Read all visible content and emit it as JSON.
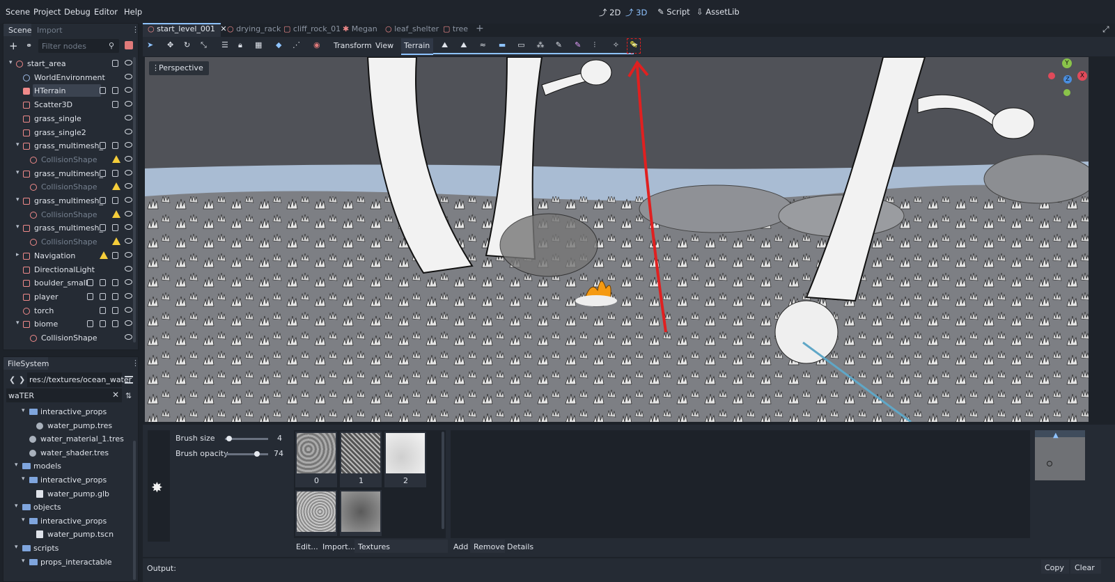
{
  "menubar": {
    "items": [
      "Scene",
      "Project",
      "Debug",
      "Editor",
      "Help"
    ],
    "modes": [
      {
        "label": "2D",
        "icon": "2d-icon",
        "active": false
      },
      {
        "label": "3D",
        "icon": "3d-icon",
        "active": true
      },
      {
        "label": "Script",
        "icon": "script-icon",
        "active": false
      },
      {
        "label": "AssetLib",
        "icon": "assetlib-icon",
        "active": false
      }
    ]
  },
  "scene_dock": {
    "tabs": [
      "Scene",
      "Import"
    ],
    "filter_placeholder": "Filter nodes",
    "nodes": [
      {
        "label": "start_area",
        "depth": 0,
        "dim": false
      },
      {
        "label": "WorldEnvironment",
        "depth": 1,
        "dim": false
      },
      {
        "label": "HTerrain",
        "depth": 1,
        "dim": false
      },
      {
        "label": "Scatter3D",
        "depth": 1,
        "dim": false
      },
      {
        "label": "grass_single",
        "depth": 1,
        "dim": false
      },
      {
        "label": "grass_single2",
        "depth": 1,
        "dim": false
      },
      {
        "label": "grass_multimesh_",
        "depth": 1,
        "dim": false
      },
      {
        "label": "CollisionShape",
        "depth": 2,
        "dim": true
      },
      {
        "label": "grass_multimesh_",
        "depth": 1,
        "dim": false
      },
      {
        "label": "CollisionShape",
        "depth": 2,
        "dim": true
      },
      {
        "label": "grass_multimesh_",
        "depth": 1,
        "dim": false
      },
      {
        "label": "CollisionShape",
        "depth": 2,
        "dim": true
      },
      {
        "label": "grass_multimesh_",
        "depth": 1,
        "dim": false
      },
      {
        "label": "CollisionShape",
        "depth": 2,
        "dim": true
      },
      {
        "label": "Navigation",
        "depth": 1,
        "dim": false
      },
      {
        "label": "DirectionalLight",
        "depth": 1,
        "dim": false
      },
      {
        "label": "boulder_small",
        "depth": 1,
        "dim": false
      },
      {
        "label": "player",
        "depth": 1,
        "dim": false
      },
      {
        "label": "torch",
        "depth": 1,
        "dim": false
      },
      {
        "label": "biome",
        "depth": 1,
        "dim": false
      },
      {
        "label": "CollisionShape",
        "depth": 2,
        "dim": false
      }
    ]
  },
  "filesystem": {
    "title": "FileSystem",
    "path": "res://textures/ocean_water",
    "search": "waTER",
    "items": [
      {
        "label": "interactive_props",
        "type": "folder",
        "depth": 1
      },
      {
        "label": "water_pump.tres",
        "type": "resource",
        "depth": 2
      },
      {
        "label": "water_material_1.tres",
        "type": "resource",
        "depth": 1
      },
      {
        "label": "water_shader.tres",
        "type": "resource",
        "depth": 1
      },
      {
        "label": "models",
        "type": "folder",
        "depth": 0
      },
      {
        "label": "interactive_props",
        "type": "folder",
        "depth": 1
      },
      {
        "label": "water_pump.glb",
        "type": "file",
        "depth": 2
      },
      {
        "label": "objects",
        "type": "folder",
        "depth": 0
      },
      {
        "label": "interactive_props",
        "type": "folder",
        "depth": 1
      },
      {
        "label": "water_pump.tscn",
        "type": "file",
        "depth": 2
      },
      {
        "label": "scripts",
        "type": "folder",
        "depth": 0
      },
      {
        "label": "props_interactable",
        "type": "folder",
        "depth": 1
      }
    ]
  },
  "doc_tabs": [
    {
      "label": "start_level_001",
      "active": true
    },
    {
      "label": "drying_rack",
      "active": false
    },
    {
      "label": "cliff_rock_01",
      "active": false
    },
    {
      "label": "Megan",
      "active": false
    },
    {
      "label": "leaf_shelter",
      "active": false
    },
    {
      "label": "tree",
      "active": false
    }
  ],
  "toolbar": {
    "menus": [
      "Transform",
      "View",
      "Terrain"
    ]
  },
  "viewport": {
    "perspective_label": "Perspective",
    "gizmo": {
      "y": "Y",
      "z": "Z",
      "x": "X"
    }
  },
  "terrain_panel": {
    "brush_size_label": "Brush size",
    "brush_size_value": "4",
    "brush_size_fraction": 0.1,
    "brush_opacity_label": "Brush opacity",
    "brush_opacity_value": "74",
    "brush_opacity_fraction": 0.74,
    "textures": [
      "0",
      "1",
      "2"
    ],
    "texture_tabs": [
      "Edit...",
      "Import...",
      "Textures"
    ],
    "detail_tabs": [
      "Add",
      "Remove",
      "Details"
    ]
  },
  "output": {
    "label": "Output:",
    "copy": "Copy",
    "clear": "Clear"
  },
  "colors": {
    "accent": "#8ec3ff",
    "warning": "#f5cd3a",
    "annotation_red": "#e02020"
  }
}
